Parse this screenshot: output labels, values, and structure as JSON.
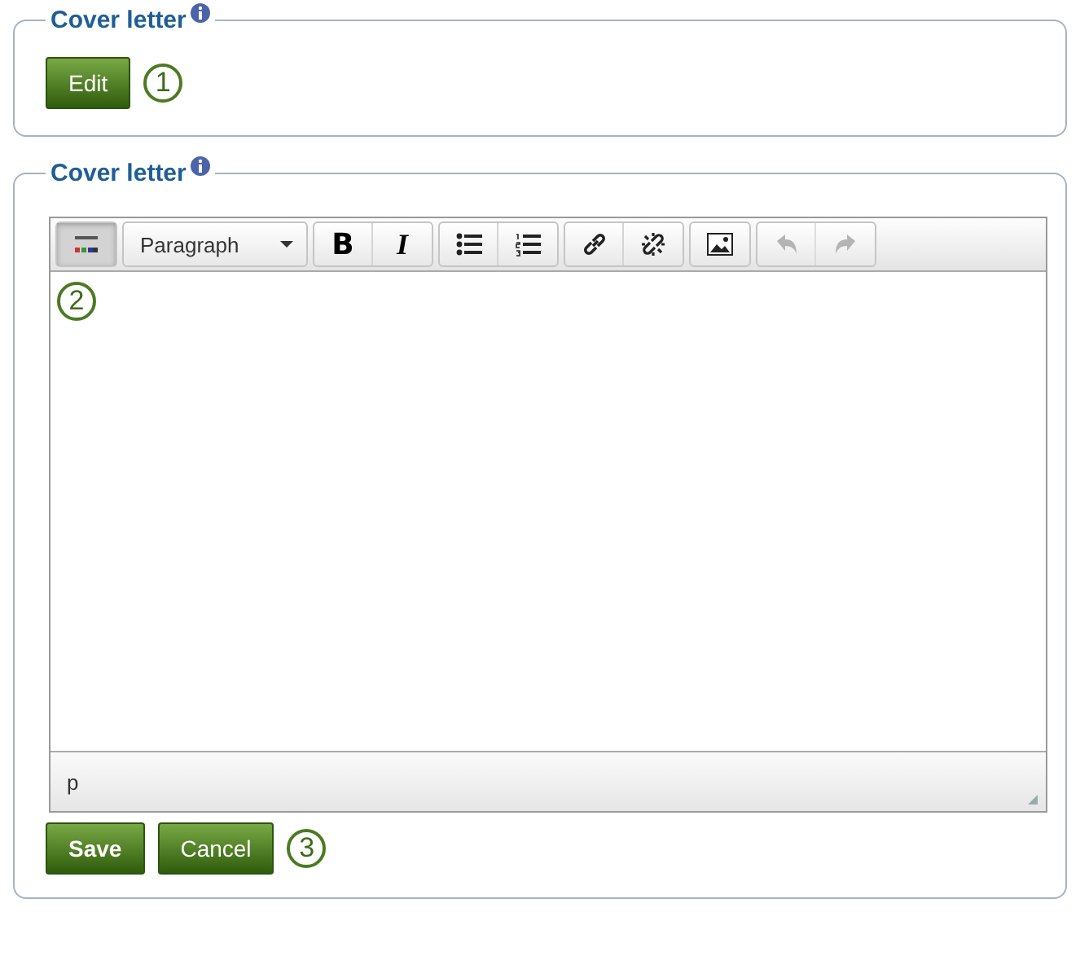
{
  "sections": [
    {
      "legend": "Cover letter",
      "kind": "view",
      "buttons": [
        {
          "label": "Edit",
          "bold": false
        }
      ],
      "callout": "1"
    },
    {
      "legend": "Cover letter",
      "kind": "editor",
      "editor": {
        "toolbar": [
          [
            {
              "kind": "toggle",
              "selected": true,
              "disabled": false
            }
          ],
          [
            {
              "kind": "dropdown",
              "label": "Paragraph",
              "selected": false,
              "disabled": false
            }
          ],
          [
            {
              "kind": "bold",
              "label": "B",
              "selected": false,
              "disabled": false
            },
            {
              "kind": "italic",
              "label": "I",
              "selected": false,
              "disabled": false
            }
          ],
          [
            {
              "kind": "bullets",
              "selected": false,
              "disabled": false
            },
            {
              "kind": "numbers",
              "selected": false,
              "disabled": false
            }
          ],
          [
            {
              "kind": "link",
              "selected": false,
              "disabled": false
            },
            {
              "kind": "unlink",
              "selected": false,
              "disabled": false
            }
          ],
          [
            {
              "kind": "image",
              "selected": false,
              "disabled": false
            }
          ],
          [
            {
              "kind": "undo",
              "selected": false,
              "disabled": true
            },
            {
              "kind": "redo",
              "selected": false,
              "disabled": true
            }
          ]
        ],
        "callout": "2",
        "path": "p"
      },
      "buttons": [
        {
          "label": "Save",
          "bold": true
        },
        {
          "label": "Cancel",
          "bold": false
        }
      ],
      "callout": "3"
    }
  ]
}
